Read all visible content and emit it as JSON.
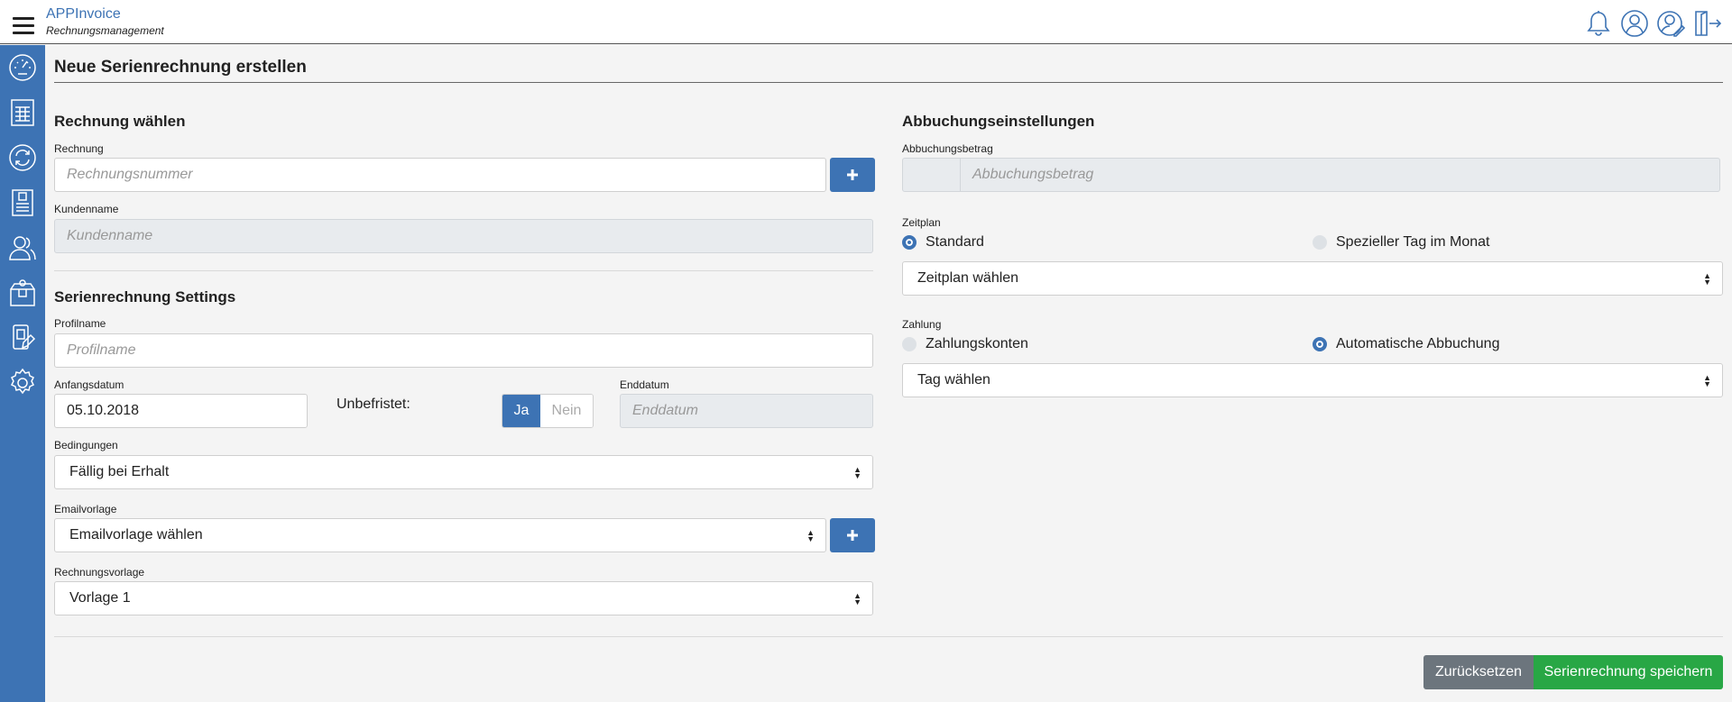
{
  "app": {
    "name": "APPInvoice",
    "subtitle": "Rechnungsmanagement"
  },
  "colors": {
    "accent": "#3d73b4",
    "success": "#28a745",
    "secondary": "#6c757d"
  },
  "topbar_icons": [
    "bell-icon",
    "user-icon",
    "user-edit-icon",
    "logout-icon"
  ],
  "sidebar_icons": [
    "dashboard-icon",
    "invoice-table-icon",
    "recurring-icon",
    "bill-icon",
    "customers-icon",
    "products-icon",
    "payment-icon",
    "settings-icon"
  ],
  "page": {
    "title": "Neue Serienrechnung erstellen"
  },
  "left": {
    "invoice_section": "Rechnung wählen",
    "invoice_label": "Rechnung",
    "invoice_placeholder": "Rechnungsnummer",
    "customer_label": "Kundenname",
    "customer_placeholder": "Kundenname",
    "settings_section": "Serienrechnung Settings",
    "profile_label": "Profilname",
    "profile_placeholder": "Profilname",
    "start_label": "Anfangsdatum",
    "start_value": "05.10.2018",
    "unlimited_label": "Unbefristet:",
    "toggle_yes": "Ja",
    "toggle_no": "Nein",
    "end_label": "Enddatum",
    "end_placeholder": "Enddatum",
    "terms_label": "Bedingungen",
    "terms_value": "Fällig bei Erhalt",
    "email_label": "Emailvorlage",
    "email_value": "Emailvorlage wählen",
    "template_label": "Rechnungsvorlage",
    "template_value": "Vorlage 1"
  },
  "right": {
    "section": "Abbuchungseinstellungen",
    "amount_label": "Abbuchungsbetrag",
    "amount_placeholder": "Abbuchungsbetrag",
    "schedule_label": "Zeitplan",
    "schedule_opt1": "Standard",
    "schedule_opt2": "Spezieller Tag im Monat",
    "schedule_selected": "Standard",
    "schedule_select": "Zeitplan wählen",
    "payment_label": "Zahlung",
    "payment_opt1": "Zahlungskonten",
    "payment_opt2": "Automatische Abbuchung",
    "payment_selected": "Automatische Abbuchung",
    "day_select": "Tag wählen"
  },
  "actions": {
    "reset": "Zurücksetzen",
    "save": "Serienrechnung speichern"
  }
}
